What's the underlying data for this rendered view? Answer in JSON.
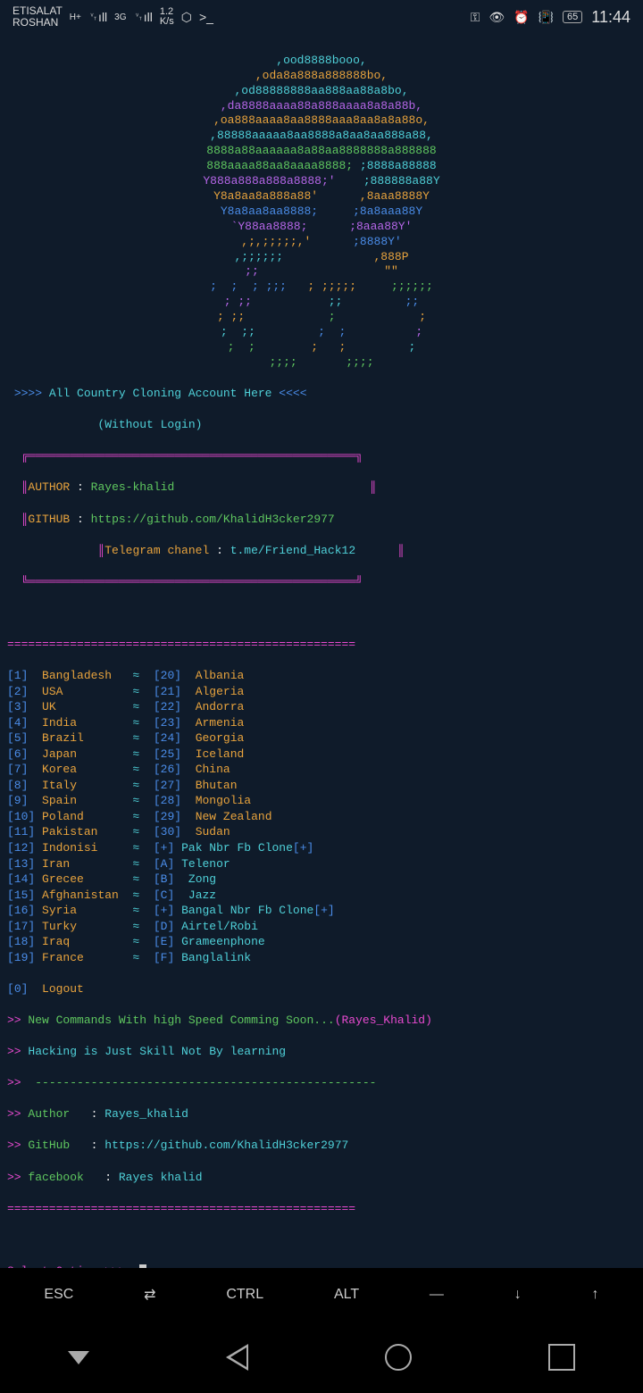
{
  "status": {
    "carrier1": "ETISALAT",
    "carrier2": "ROSHAN",
    "signal1": "H+",
    "signal2": "3G",
    "speed": "1.2",
    "speed_unit": "K/s",
    "battery": "65",
    "time": "11:44"
  },
  "banner": {
    "title_prefix": ">>>>",
    "title": "All Country Cloning Account Here",
    "title_suffix": "<<<<",
    "subtitle": "(Without Login)",
    "author_label": "AUTHOR",
    "author": "Rayes-khalid",
    "github_label": "GITHUB",
    "github": "https://github.com/KhalidH3cker2977",
    "telegram_label": "Telegram chanel",
    "telegram": "t.me/Friend_Hack12"
  },
  "menu_left": [
    {
      "n": "1",
      "name": "Bangladesh"
    },
    {
      "n": "2",
      "name": "USA"
    },
    {
      "n": "3",
      "name": "UK"
    },
    {
      "n": "4",
      "name": "India"
    },
    {
      "n": "5",
      "name": "Brazil"
    },
    {
      "n": "6",
      "name": "Japan"
    },
    {
      "n": "7",
      "name": "Korea"
    },
    {
      "n": "8",
      "name": "Italy"
    },
    {
      "n": "9",
      "name": "Spain"
    },
    {
      "n": "10",
      "name": "Poland"
    },
    {
      "n": "11",
      "name": "Pakistan"
    },
    {
      "n": "12",
      "name": "Indonisi"
    },
    {
      "n": "13",
      "name": "Iran"
    },
    {
      "n": "14",
      "name": "Grecee"
    },
    {
      "n": "15",
      "name": "Afghanistan"
    },
    {
      "n": "16",
      "name": "Syria"
    },
    {
      "n": "17",
      "name": "Turky"
    },
    {
      "n": "18",
      "name": "Iraq"
    },
    {
      "n": "19",
      "name": "France"
    }
  ],
  "menu_right": [
    {
      "n": "20",
      "name": "Albania"
    },
    {
      "n": "21",
      "name": "Algeria"
    },
    {
      "n": "22",
      "name": "Andorra"
    },
    {
      "n": "23",
      "name": "Armenia"
    },
    {
      "n": "24",
      "name": "Georgia"
    },
    {
      "n": "25",
      "name": "Iceland"
    },
    {
      "n": "26",
      "name": "China"
    },
    {
      "n": "27",
      "name": "Bhutan"
    },
    {
      "n": "28",
      "name": "Mongolia"
    },
    {
      "n": "29",
      "name": "New Zealand"
    },
    {
      "n": "30",
      "name": "Sudan"
    }
  ],
  "menu_extra": [
    {
      "k": "+",
      "name": "Pak Nbr Fb Clone",
      "suffix": "[+]"
    },
    {
      "k": "A",
      "name": "Telenor"
    },
    {
      "k": "B",
      "name": " Zong"
    },
    {
      "k": "C",
      "name": " Jazz"
    },
    {
      "k": "+",
      "name": "Bangal Nbr Fb Clone",
      "suffix": "[+]"
    },
    {
      "k": "D",
      "name": "Airtel/Robi"
    },
    {
      "k": "E",
      "name": "Grameenphone"
    },
    {
      "k": "F",
      "name": "Banglalink"
    }
  ],
  "logout": {
    "n": "0",
    "name": "Logout"
  },
  "footer": {
    "line1a": "New Commands With high Speed Comming Soon...",
    "line1b": "(Rayes_Khalid)",
    "line2": "Hacking is Just Skill Not By learning",
    "dashes": "-------------------------------------------------",
    "author_l": "Author",
    "author_v": "Rayes_khalid",
    "github_l": "GitHub",
    "github_v": "https://github.com/KhalidH3cker2977",
    "fb_l": "facebook",
    "fb_v": "Rayes khalid"
  },
  "prompt": "Select Option >>>",
  "keys": {
    "esc": "ESC",
    "ctrl": "CTRL",
    "alt": "ALT",
    "dash": "—",
    "down": "↓",
    "up": "↑",
    "tab": "⇄"
  },
  "div": "=================================================="
}
